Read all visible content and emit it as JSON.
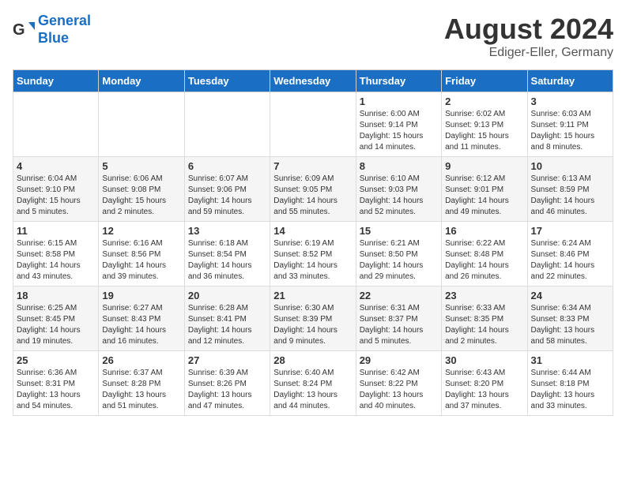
{
  "logo": {
    "line1": "General",
    "line2": "Blue"
  },
  "title": "August 2024",
  "location": "Ediger-Eller, Germany",
  "days_of_week": [
    "Sunday",
    "Monday",
    "Tuesday",
    "Wednesday",
    "Thursday",
    "Friday",
    "Saturday"
  ],
  "weeks": [
    [
      {
        "day": "",
        "info": ""
      },
      {
        "day": "",
        "info": ""
      },
      {
        "day": "",
        "info": ""
      },
      {
        "day": "",
        "info": ""
      },
      {
        "day": "1",
        "info": "Sunrise: 6:00 AM\nSunset: 9:14 PM\nDaylight: 15 hours and 14 minutes."
      },
      {
        "day": "2",
        "info": "Sunrise: 6:02 AM\nSunset: 9:13 PM\nDaylight: 15 hours and 11 minutes."
      },
      {
        "day": "3",
        "info": "Sunrise: 6:03 AM\nSunset: 9:11 PM\nDaylight: 15 hours and 8 minutes."
      }
    ],
    [
      {
        "day": "4",
        "info": "Sunrise: 6:04 AM\nSunset: 9:10 PM\nDaylight: 15 hours and 5 minutes."
      },
      {
        "day": "5",
        "info": "Sunrise: 6:06 AM\nSunset: 9:08 PM\nDaylight: 15 hours and 2 minutes."
      },
      {
        "day": "6",
        "info": "Sunrise: 6:07 AM\nSunset: 9:06 PM\nDaylight: 14 hours and 59 minutes."
      },
      {
        "day": "7",
        "info": "Sunrise: 6:09 AM\nSunset: 9:05 PM\nDaylight: 14 hours and 55 minutes."
      },
      {
        "day": "8",
        "info": "Sunrise: 6:10 AM\nSunset: 9:03 PM\nDaylight: 14 hours and 52 minutes."
      },
      {
        "day": "9",
        "info": "Sunrise: 6:12 AM\nSunset: 9:01 PM\nDaylight: 14 hours and 49 minutes."
      },
      {
        "day": "10",
        "info": "Sunrise: 6:13 AM\nSunset: 8:59 PM\nDaylight: 14 hours and 46 minutes."
      }
    ],
    [
      {
        "day": "11",
        "info": "Sunrise: 6:15 AM\nSunset: 8:58 PM\nDaylight: 14 hours and 43 minutes."
      },
      {
        "day": "12",
        "info": "Sunrise: 6:16 AM\nSunset: 8:56 PM\nDaylight: 14 hours and 39 minutes."
      },
      {
        "day": "13",
        "info": "Sunrise: 6:18 AM\nSunset: 8:54 PM\nDaylight: 14 hours and 36 minutes."
      },
      {
        "day": "14",
        "info": "Sunrise: 6:19 AM\nSunset: 8:52 PM\nDaylight: 14 hours and 33 minutes."
      },
      {
        "day": "15",
        "info": "Sunrise: 6:21 AM\nSunset: 8:50 PM\nDaylight: 14 hours and 29 minutes."
      },
      {
        "day": "16",
        "info": "Sunrise: 6:22 AM\nSunset: 8:48 PM\nDaylight: 14 hours and 26 minutes."
      },
      {
        "day": "17",
        "info": "Sunrise: 6:24 AM\nSunset: 8:46 PM\nDaylight: 14 hours and 22 minutes."
      }
    ],
    [
      {
        "day": "18",
        "info": "Sunrise: 6:25 AM\nSunset: 8:45 PM\nDaylight: 14 hours and 19 minutes."
      },
      {
        "day": "19",
        "info": "Sunrise: 6:27 AM\nSunset: 8:43 PM\nDaylight: 14 hours and 16 minutes."
      },
      {
        "day": "20",
        "info": "Sunrise: 6:28 AM\nSunset: 8:41 PM\nDaylight: 14 hours and 12 minutes."
      },
      {
        "day": "21",
        "info": "Sunrise: 6:30 AM\nSunset: 8:39 PM\nDaylight: 14 hours and 9 minutes."
      },
      {
        "day": "22",
        "info": "Sunrise: 6:31 AM\nSunset: 8:37 PM\nDaylight: 14 hours and 5 minutes."
      },
      {
        "day": "23",
        "info": "Sunrise: 6:33 AM\nSunset: 8:35 PM\nDaylight: 14 hours and 2 minutes."
      },
      {
        "day": "24",
        "info": "Sunrise: 6:34 AM\nSunset: 8:33 PM\nDaylight: 13 hours and 58 minutes."
      }
    ],
    [
      {
        "day": "25",
        "info": "Sunrise: 6:36 AM\nSunset: 8:31 PM\nDaylight: 13 hours and 54 minutes."
      },
      {
        "day": "26",
        "info": "Sunrise: 6:37 AM\nSunset: 8:28 PM\nDaylight: 13 hours and 51 minutes."
      },
      {
        "day": "27",
        "info": "Sunrise: 6:39 AM\nSunset: 8:26 PM\nDaylight: 13 hours and 47 minutes."
      },
      {
        "day": "28",
        "info": "Sunrise: 6:40 AM\nSunset: 8:24 PM\nDaylight: 13 hours and 44 minutes."
      },
      {
        "day": "29",
        "info": "Sunrise: 6:42 AM\nSunset: 8:22 PM\nDaylight: 13 hours and 40 minutes."
      },
      {
        "day": "30",
        "info": "Sunrise: 6:43 AM\nSunset: 8:20 PM\nDaylight: 13 hours and 37 minutes."
      },
      {
        "day": "31",
        "info": "Sunrise: 6:44 AM\nSunset: 8:18 PM\nDaylight: 13 hours and 33 minutes."
      }
    ]
  ]
}
